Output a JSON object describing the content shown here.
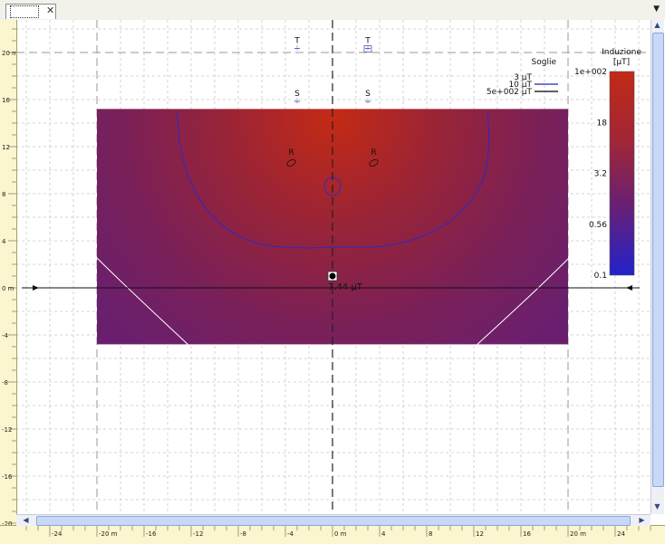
{
  "tab": {
    "close_glyph": "✕",
    "menu_glyph": "▼"
  },
  "canvas": {
    "x_range": [
      -26,
      27
    ],
    "y_range": [
      -20,
      22.5
    ]
  },
  "axes": {
    "x_ticks": [
      {
        "v": -24,
        "label": "-24"
      },
      {
        "v": -20,
        "label": "-20 m"
      },
      {
        "v": -16,
        "label": "-16"
      },
      {
        "v": -12,
        "label": "-12"
      },
      {
        "v": -8,
        "label": "-8"
      },
      {
        "v": -4,
        "label": "-4"
      },
      {
        "v": 0,
        "label": "0 m"
      },
      {
        "v": 4,
        "label": "4"
      },
      {
        "v": 8,
        "label": "8"
      },
      {
        "v": 12,
        "label": "12"
      },
      {
        "v": 16,
        "label": "16"
      },
      {
        "v": 20,
        "label": "20 m"
      },
      {
        "v": 24,
        "label": "24"
      }
    ],
    "y_ticks": [
      {
        "v": 20,
        "label": "20 m"
      },
      {
        "v": 16,
        "label": "16"
      },
      {
        "v": 12,
        "label": "12"
      },
      {
        "v": 8,
        "label": "8"
      },
      {
        "v": 4,
        "label": "4"
      },
      {
        "v": 0,
        "label": "0 m"
      },
      {
        "v": -4,
        "label": "-4"
      },
      {
        "v": -8,
        "label": "-8"
      },
      {
        "v": -12,
        "label": "-12"
      },
      {
        "v": -16,
        "label": "-16"
      },
      {
        "v": -20,
        "label": "-20"
      }
    ]
  },
  "field_map": {
    "x_range": [
      -20,
      20
    ],
    "y_range": [
      -4.8,
      15.2
    ],
    "max_color": "#c42a14",
    "min_color": "#6a1f6e"
  },
  "markers": [
    {
      "label": "T",
      "x": -3,
      "y": 20.5
    },
    {
      "label": "T",
      "x": 3,
      "y": 20.5
    },
    {
      "label": "S",
      "x": -3,
      "y": 16
    },
    {
      "label": "S",
      "x": 3,
      "y": 16
    },
    {
      "label": "R",
      "x": -3.5,
      "y": 11
    },
    {
      "label": "R",
      "x": 3.5,
      "y": 11
    }
  ],
  "probe": {
    "x": 0,
    "y": 1,
    "value_label": "7.44 µT"
  },
  "legend": {
    "title": "Soglie",
    "entries": [
      {
        "label": "3 µT",
        "color": "#ffffff"
      },
      {
        "label": "10 µT",
        "color": "#2020c0"
      },
      {
        "label": "5e+002 µT",
        "color": "#000000"
      }
    ]
  },
  "colorbar": {
    "title": "Induzione",
    "unit": "[µT]",
    "ticks": [
      "1e+002",
      "18",
      "3.2",
      "0.56",
      "0.1"
    ],
    "top_color": "#c22a16",
    "bottom_color": "#2222cc"
  }
}
